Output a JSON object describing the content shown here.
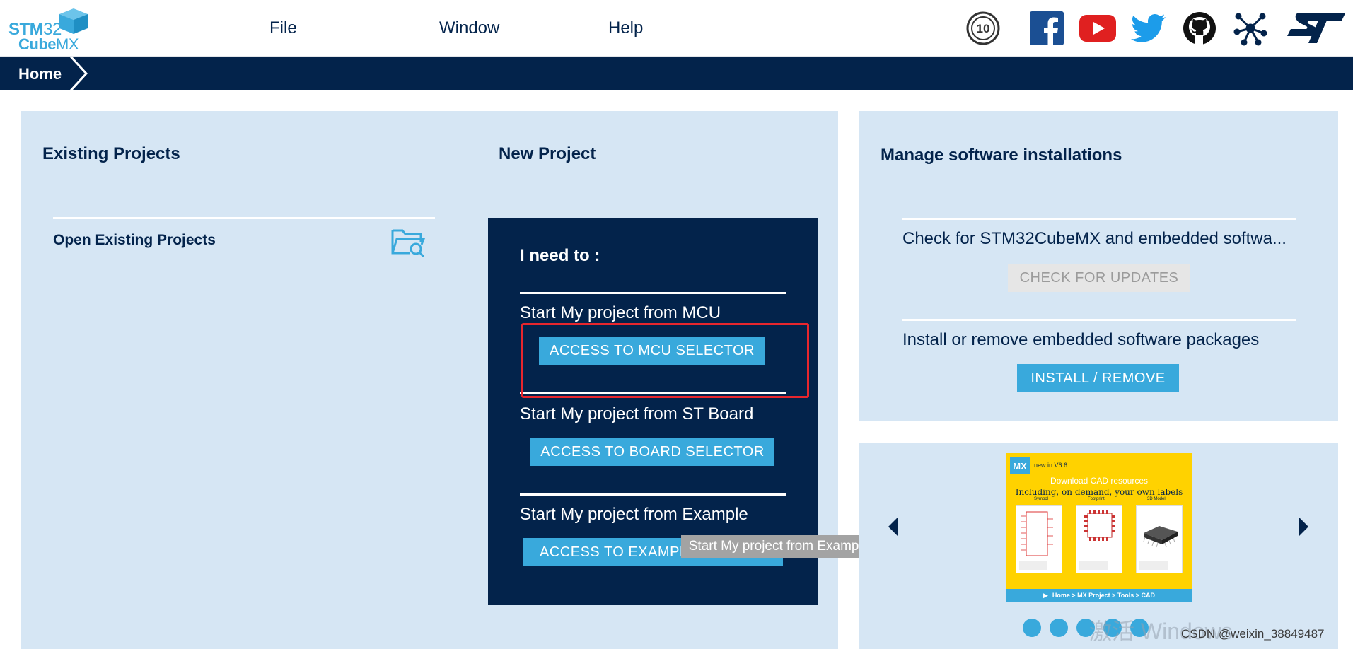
{
  "app": {
    "logo_top": "STM",
    "logo_top_num": "32",
    "logo_bottom": "Cube",
    "logo_bottom_mx": "MX"
  },
  "menu": [
    {
      "label": "File"
    },
    {
      "label": "Window"
    },
    {
      "label": "Help"
    }
  ],
  "social_icons": [
    "anniversary-10-icon",
    "facebook-icon",
    "youtube-icon",
    "twitter-icon",
    "github-icon",
    "network-icon",
    "st-logo-icon"
  ],
  "breadcrumb": {
    "home": "Home"
  },
  "existing_projects": {
    "title": "Existing Projects",
    "open_label": "Open Existing Projects"
  },
  "new_project": {
    "title": "New Project",
    "need_to": "I need to :",
    "mcu_label": "Start My project from MCU",
    "mcu_button": "ACCESS TO MCU SELECTOR",
    "board_label": "Start My project from ST Board",
    "board_button": "ACCESS TO BOARD SELECTOR",
    "example_label": "Start My project from Example",
    "example_button": "ACCESS TO EXAMPLE SELECTOR",
    "tooltip": "Start My project from Example"
  },
  "manage": {
    "title": "Manage software installations",
    "check_text": "Check for STM32CubeMX and embedded softwa...",
    "check_button": "CHECK FOR UPDATES",
    "install_text": "Install or remove embedded software packages",
    "install_button": "INSTALL / REMOVE"
  },
  "carousel": {
    "badge": "MX",
    "new_in": "new in V6.6",
    "line1": "Download CAD resources",
    "line2": "Including, on demand, your own labels",
    "cards": [
      "Symbol",
      "Footprint",
      "3D Model"
    ],
    "footer": "Home > MX Project > Tools > CAD",
    "dot_count": 5
  },
  "overlay": {
    "watermark_main": "激活 Windows",
    "credit": "CSDN @weixin_38849487"
  },
  "colors": {
    "navy": "#03234b",
    "accent": "#39a9dc",
    "panel": "#d6e6f4",
    "highlight": "#e8262d"
  }
}
